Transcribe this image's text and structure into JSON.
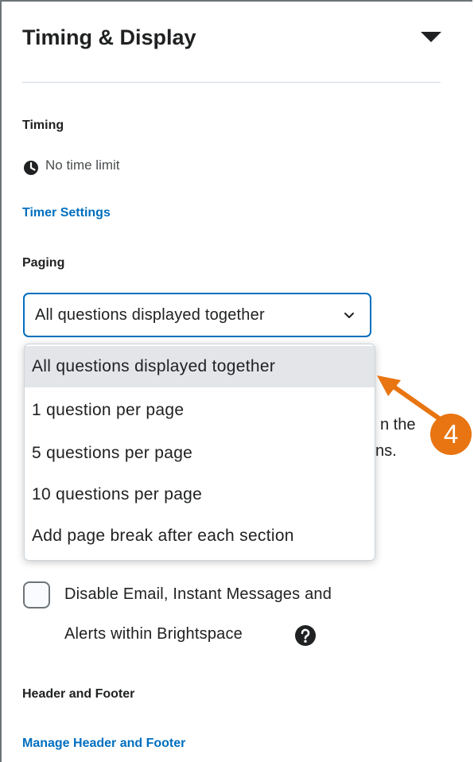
{
  "panel": {
    "title": "Timing & Display"
  },
  "timing": {
    "heading": "Timing",
    "value": "No time limit",
    "link": "Timer Settings"
  },
  "paging": {
    "heading": "Paging",
    "selected": "All questions displayed together",
    "options": [
      "All questions displayed together",
      "1 question per page",
      "5 questions per page",
      "10 questions per page",
      "Add page break after each section"
    ],
    "behind_line1_fragment": "n the",
    "behind_line2_fragment": "ns."
  },
  "annotation": {
    "step": "4",
    "color": "#e87511"
  },
  "notifications": {
    "checkbox_line1": "Disable Email, Instant Messages and",
    "checkbox_line2": "Alerts within Brightspace"
  },
  "header_footer": {
    "heading": "Header and Footer",
    "link": "Manage Header and Footer"
  },
  "colors": {
    "link": "#006fbf",
    "focus_border": "#006fbf",
    "selected_item": "#e3e5e8"
  }
}
